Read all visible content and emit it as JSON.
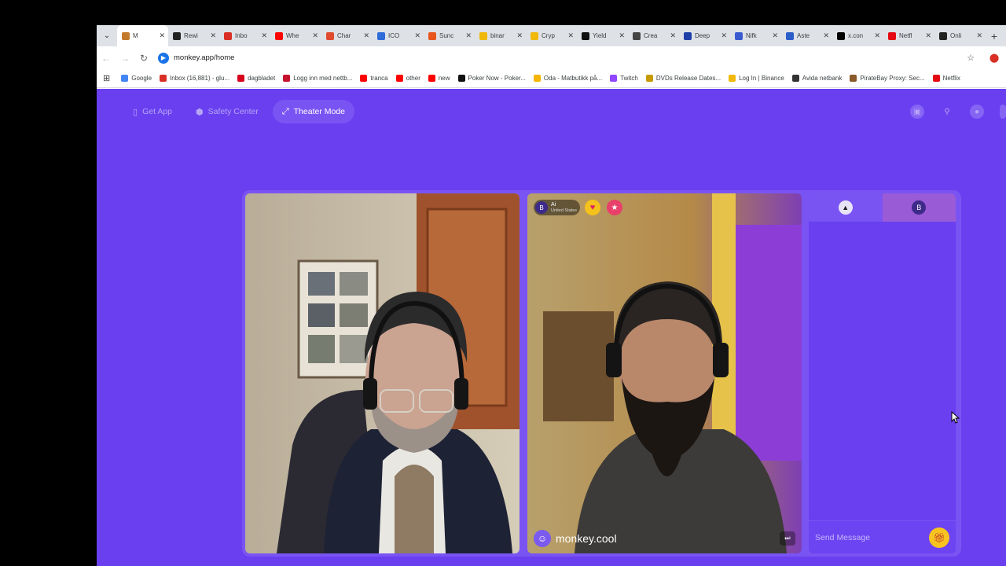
{
  "tabs": [
    {
      "label": "M",
      "icon": "monkey-icon",
      "color": "#c47a2c",
      "active": true
    },
    {
      "label": "Rewi",
      "icon": "x-icon",
      "color": "#222222"
    },
    {
      "label": "Inbo",
      "icon": "gmail-icon",
      "color": "#d93025"
    },
    {
      "label": "Whe",
      "icon": "youtube-icon",
      "color": "#ff0000"
    },
    {
      "label": "Char",
      "icon": "chart-icon",
      "color": "#e04a2f"
    },
    {
      "label": "ICO",
      "icon": "drop-icon",
      "color": "#2f6bd9"
    },
    {
      "label": "Sunc",
      "icon": "sun-icon",
      "color": "#e8561e"
    },
    {
      "label": "binar",
      "icon": "binance-icon",
      "color": "#f0b90b"
    },
    {
      "label": "Cryp",
      "icon": "crypto-icon",
      "color": "#f0b90b"
    },
    {
      "label": "Yield",
      "icon": "yield-icon",
      "color": "#111111"
    },
    {
      "label": "Crea",
      "icon": "openai-icon",
      "color": "#444444"
    },
    {
      "label": "Deep",
      "icon": "deepl-icon",
      "color": "#1f3fa8"
    },
    {
      "label": "Nifk",
      "icon": "nifk-icon",
      "color": "#3a5bd0"
    },
    {
      "label": "Aste",
      "icon": "aster-icon",
      "color": "#2b5ec9"
    },
    {
      "label": "x.con",
      "icon": "x-icon",
      "color": "#000000"
    },
    {
      "label": "Netfl",
      "icon": "netflix-icon",
      "color": "#e50914"
    },
    {
      "label": "Onli",
      "icon": "online-icon",
      "color": "#222222"
    }
  ],
  "address": {
    "url": "monkey.app/home"
  },
  "bookmarks": [
    {
      "label": "Google",
      "color": "#4285f4"
    },
    {
      "label": "Inbox (16,881) - glu...",
      "color": "#d93025"
    },
    {
      "label": "dagbladet",
      "color": "#d6001c"
    },
    {
      "label": "Logg inn med nettb...",
      "color": "#c4122f"
    },
    {
      "label": "tranca",
      "color": "#ff0000"
    },
    {
      "label": "other",
      "color": "#ff0000"
    },
    {
      "label": "new",
      "color": "#ff0000"
    },
    {
      "label": "Poker Now - Poker...",
      "color": "#111111"
    },
    {
      "label": "Oda - Matbutikk på...",
      "color": "#f4b400"
    },
    {
      "label": "Twitch",
      "color": "#9146ff"
    },
    {
      "label": "DVDs Release Dates...",
      "color": "#c79a00"
    },
    {
      "label": "Log In | Binance",
      "color": "#f0b90b"
    },
    {
      "label": "Avida netbank",
      "color": "#333333"
    },
    {
      "label": "PirateBay Proxy: Sec...",
      "color": "#8a5a2b"
    },
    {
      "label": "Netflix",
      "color": "#e50914"
    }
  ],
  "nav": {
    "get_app": "Get App",
    "safety_center": "Safety Center",
    "theater_mode": "Theater Mode"
  },
  "remote_user": {
    "avatar_letter": "B",
    "name": "Ai",
    "country": "United States"
  },
  "watermark": "monkey.cool",
  "chat": {
    "tab_avatar_letter": "B",
    "placeholder": "Send Message"
  },
  "colors": {
    "page_bg": "#6a3ff0",
    "accent": "#7a54f3",
    "gift": "#f7c320"
  }
}
